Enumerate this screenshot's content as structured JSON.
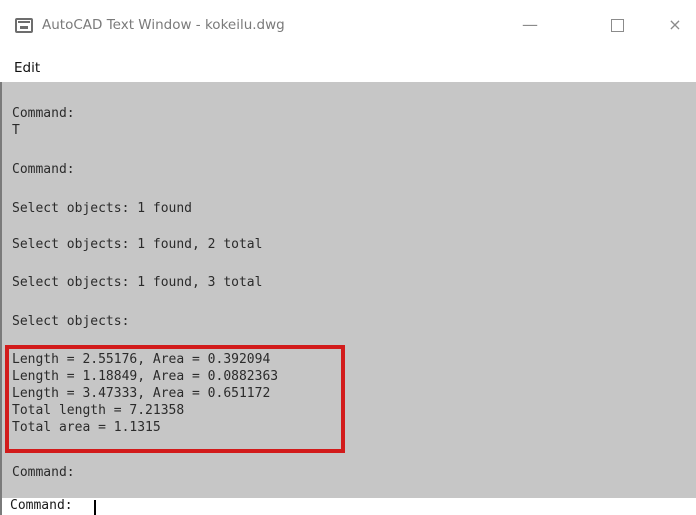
{
  "window": {
    "title": "AutoCAD Text Window - kokeilu.dwg",
    "controls": {
      "minimize": "—",
      "close": "×"
    }
  },
  "menu": {
    "edit": "Edit"
  },
  "console": {
    "lines": [
      "Command:",
      "T",
      "Command:",
      "Select objects: 1 found",
      "Select objects: 1 found, 2 total",
      "Select objects: 1 found, 3 total",
      "Select objects:",
      "Length = 2.55176, Area = 0.392094",
      "Length = 1.18849, Area = 0.0882363",
      "Length = 3.47333, Area = 0.651172",
      "Total length = 7.21358",
      "Total area = 1.1315",
      "Command:"
    ],
    "prompt": "Command: "
  },
  "colors": {
    "console_bg": "#c6c6c6",
    "highlight": "#d21b1b"
  }
}
